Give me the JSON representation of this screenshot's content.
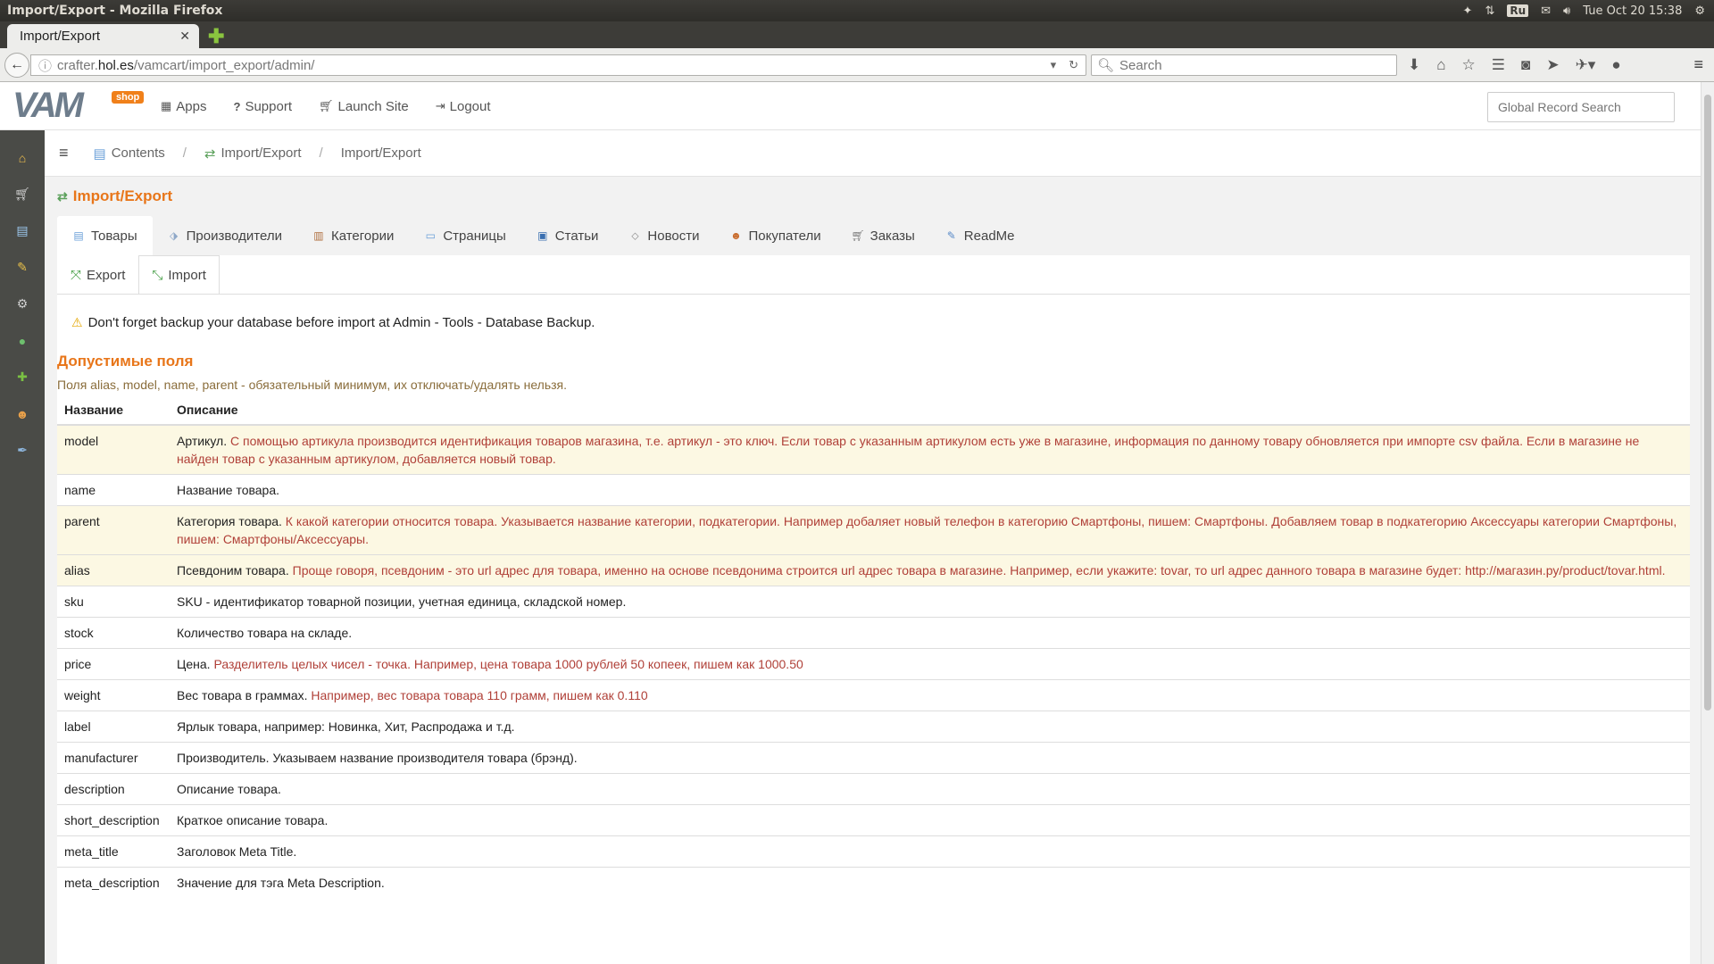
{
  "os": {
    "window_title": "Import/Export - Mozilla Firefox",
    "keyboard_layout": "Ru",
    "clock": "Tue Oct 20 15:38"
  },
  "browser": {
    "tab_title": "Import/Export",
    "url_prefix": "crafter.",
    "url_host": "hol.es",
    "url_path": "/vamcart/import_export/admin/",
    "search_placeholder": "Search"
  },
  "app": {
    "logo_text": "VAM",
    "logo_badge": "shop",
    "menu": [
      {
        "label": "Apps",
        "icon": "grid-icon"
      },
      {
        "label": "Support",
        "icon": "question-icon"
      },
      {
        "label": "Launch Site",
        "icon": "cart-icon"
      },
      {
        "label": "Logout",
        "icon": "logout-icon"
      }
    ],
    "global_search_placeholder": "Global Record Search",
    "sidebar_icons": [
      "home-icon",
      "cart-icon",
      "pages-icon",
      "brush-icon",
      "gear-icon",
      "globe-icon",
      "puzzle-icon",
      "users-icon",
      "wrench-icon"
    ]
  },
  "breadcrumb": [
    {
      "label": "Contents",
      "icon": "contents-icon"
    },
    {
      "label": "Import/Export",
      "icon": "import-export-icon"
    },
    {
      "label": "Import/Export",
      "icon": ""
    }
  ],
  "page": {
    "title": "Import/Export",
    "tabs": [
      {
        "label": "Товары",
        "icon": "products-icon"
      },
      {
        "label": "Производители",
        "icon": "tag-icon"
      },
      {
        "label": "Категории",
        "icon": "categories-icon"
      },
      {
        "label": "Страницы",
        "icon": "page-icon"
      },
      {
        "label": "Статьи",
        "icon": "articles-icon"
      },
      {
        "label": "Новости",
        "icon": "news-icon"
      },
      {
        "label": "Покупатели",
        "icon": "customers-icon"
      },
      {
        "label": "Заказы",
        "icon": "orders-icon"
      },
      {
        "label": "ReadMe",
        "icon": "readme-icon"
      }
    ],
    "subtabs": [
      {
        "label": "Export",
        "icon": "export-icon"
      },
      {
        "label": "Import",
        "icon": "import-icon"
      }
    ],
    "notice": "Don't forget backup your database before import at Admin - Tools - Database Backup.",
    "fields_title": "Допустимые поля",
    "fields_note": "Поля alias, model, name, parent - обязательный минимум, их отключать/удалять нельзя.",
    "table_headers": {
      "name": "Название",
      "description": "Описание"
    },
    "rows": [
      {
        "name": "model",
        "lead": "Артикул.",
        "desc": "С помощью артикула производится идентификация товаров магазина, т.е. артикул - это ключ. Если товар с указанным артикулом есть уже в магазине, информация по данному товару обновляется при импорте csv файла. Если в магазине не найден товар с указанным артикулом, добавляется новый товар."
      },
      {
        "name": "name",
        "lead": "Название товара.",
        "desc": ""
      },
      {
        "name": "parent",
        "lead": "Категория товара.",
        "desc": "К какой категории относится товара. Указывается название категории, подкатегории. Например добаляет новый телефон в категорию Смартфоны, пишем: Смартфоны. Добавляем товар в подкатегорию Аксессуары категории Смартфоны, пишем: Смартфоны/Аксессуары."
      },
      {
        "name": "alias",
        "lead": "Псевдоним товара.",
        "desc": "Проще говоря, псевдоним - это url адрес для товара, именно на основе псевдонима строится url адрес товара в магазине. Например, если укажите: tovar, то url адрес данного товара в магазине будет: http://магазин.ру/product/tovar.html."
      },
      {
        "name": "sku",
        "lead": "SKU - идентификатор товарной позиции, учетная единица, складской номер.",
        "desc": ""
      },
      {
        "name": "stock",
        "lead": "Количество товара на складе.",
        "desc": ""
      },
      {
        "name": "price",
        "lead": "Цена.",
        "desc": "Разделитель целых чисел - точка. Например, цена товара 1000 рублей 50 копеек, пишем как 1000.50"
      },
      {
        "name": "weight",
        "lead": "Вес товара в граммах.",
        "desc": "Например, вес товара товара 110 грамм, пишем как 0.110"
      },
      {
        "name": "label",
        "lead": "Ярлык товара, например: Новинка, Хит, Распродажа и т.д.",
        "desc": ""
      },
      {
        "name": "manufacturer",
        "lead": "Производитель. Указываем название производителя товара (брэнд).",
        "desc": ""
      },
      {
        "name": "description",
        "lead": "Описание товара.",
        "desc": ""
      },
      {
        "name": "short_description",
        "lead": "Краткое описание товара.",
        "desc": ""
      },
      {
        "name": "meta_title",
        "lead": "Заголовок Meta Title.",
        "desc": ""
      },
      {
        "name": "meta_description",
        "lead": "Значение для тэга Meta Description.",
        "desc": ""
      }
    ]
  },
  "colors": {
    "accent_orange": "#e8761a",
    "sidebar_bg": "#4a4b47",
    "required_row_bg": "#fcf8e3",
    "hint_red": "#b04038"
  }
}
